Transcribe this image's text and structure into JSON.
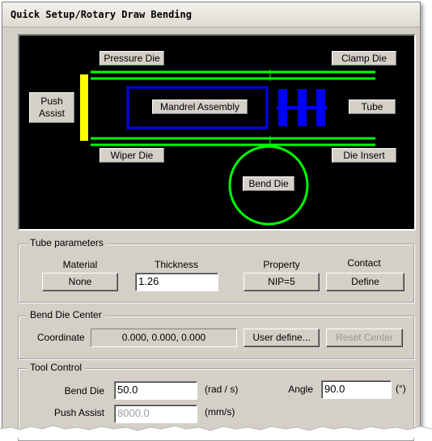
{
  "window": {
    "title": "Quick Setup/Rotary Draw Bending"
  },
  "diagram": {
    "pressure_die": "Pressure Die",
    "clamp_die": "Clamp Die",
    "push_assist_line1": "Push",
    "push_assist_line2": "Assist",
    "mandrel_assembly": "Mandrel Assembly",
    "tube": "Tube",
    "wiper_die": "Wiper Die",
    "die_insert": "Die Insert",
    "bend_die": "Bend Die",
    "colors": {
      "tube_lines": "#00ff00",
      "mandrel": "#0000ff",
      "push_assist": "#ffff00",
      "background": "#000000"
    }
  },
  "tube_parameters": {
    "legend": "Tube parameters",
    "material_label": "Material",
    "material_value": "None",
    "thickness_label": "Thickness",
    "thickness_value": "1.26",
    "property_label": "Property",
    "property_value": "NIP=5",
    "contact_label": "Contact",
    "contact_value": "Define"
  },
  "bend_die_center": {
    "legend": "Bend Die Center",
    "coordinate_label": "Coordinate",
    "coordinate_value": "0.000,  0.000,  0.000",
    "user_define": "User define...",
    "reset_center": "Reset Center"
  },
  "tool_control": {
    "legend": "Tool Control",
    "bend_die_label": "Bend Die",
    "bend_die_value": "50.0",
    "bend_die_unit": "(rad / s)",
    "angle_label": "Angle",
    "angle_value": "90.0",
    "angle_unit": "(°)",
    "push_assist_label": "Push Assist",
    "push_assist_value": "8000.0",
    "push_assist_unit": "(mm/s)"
  }
}
